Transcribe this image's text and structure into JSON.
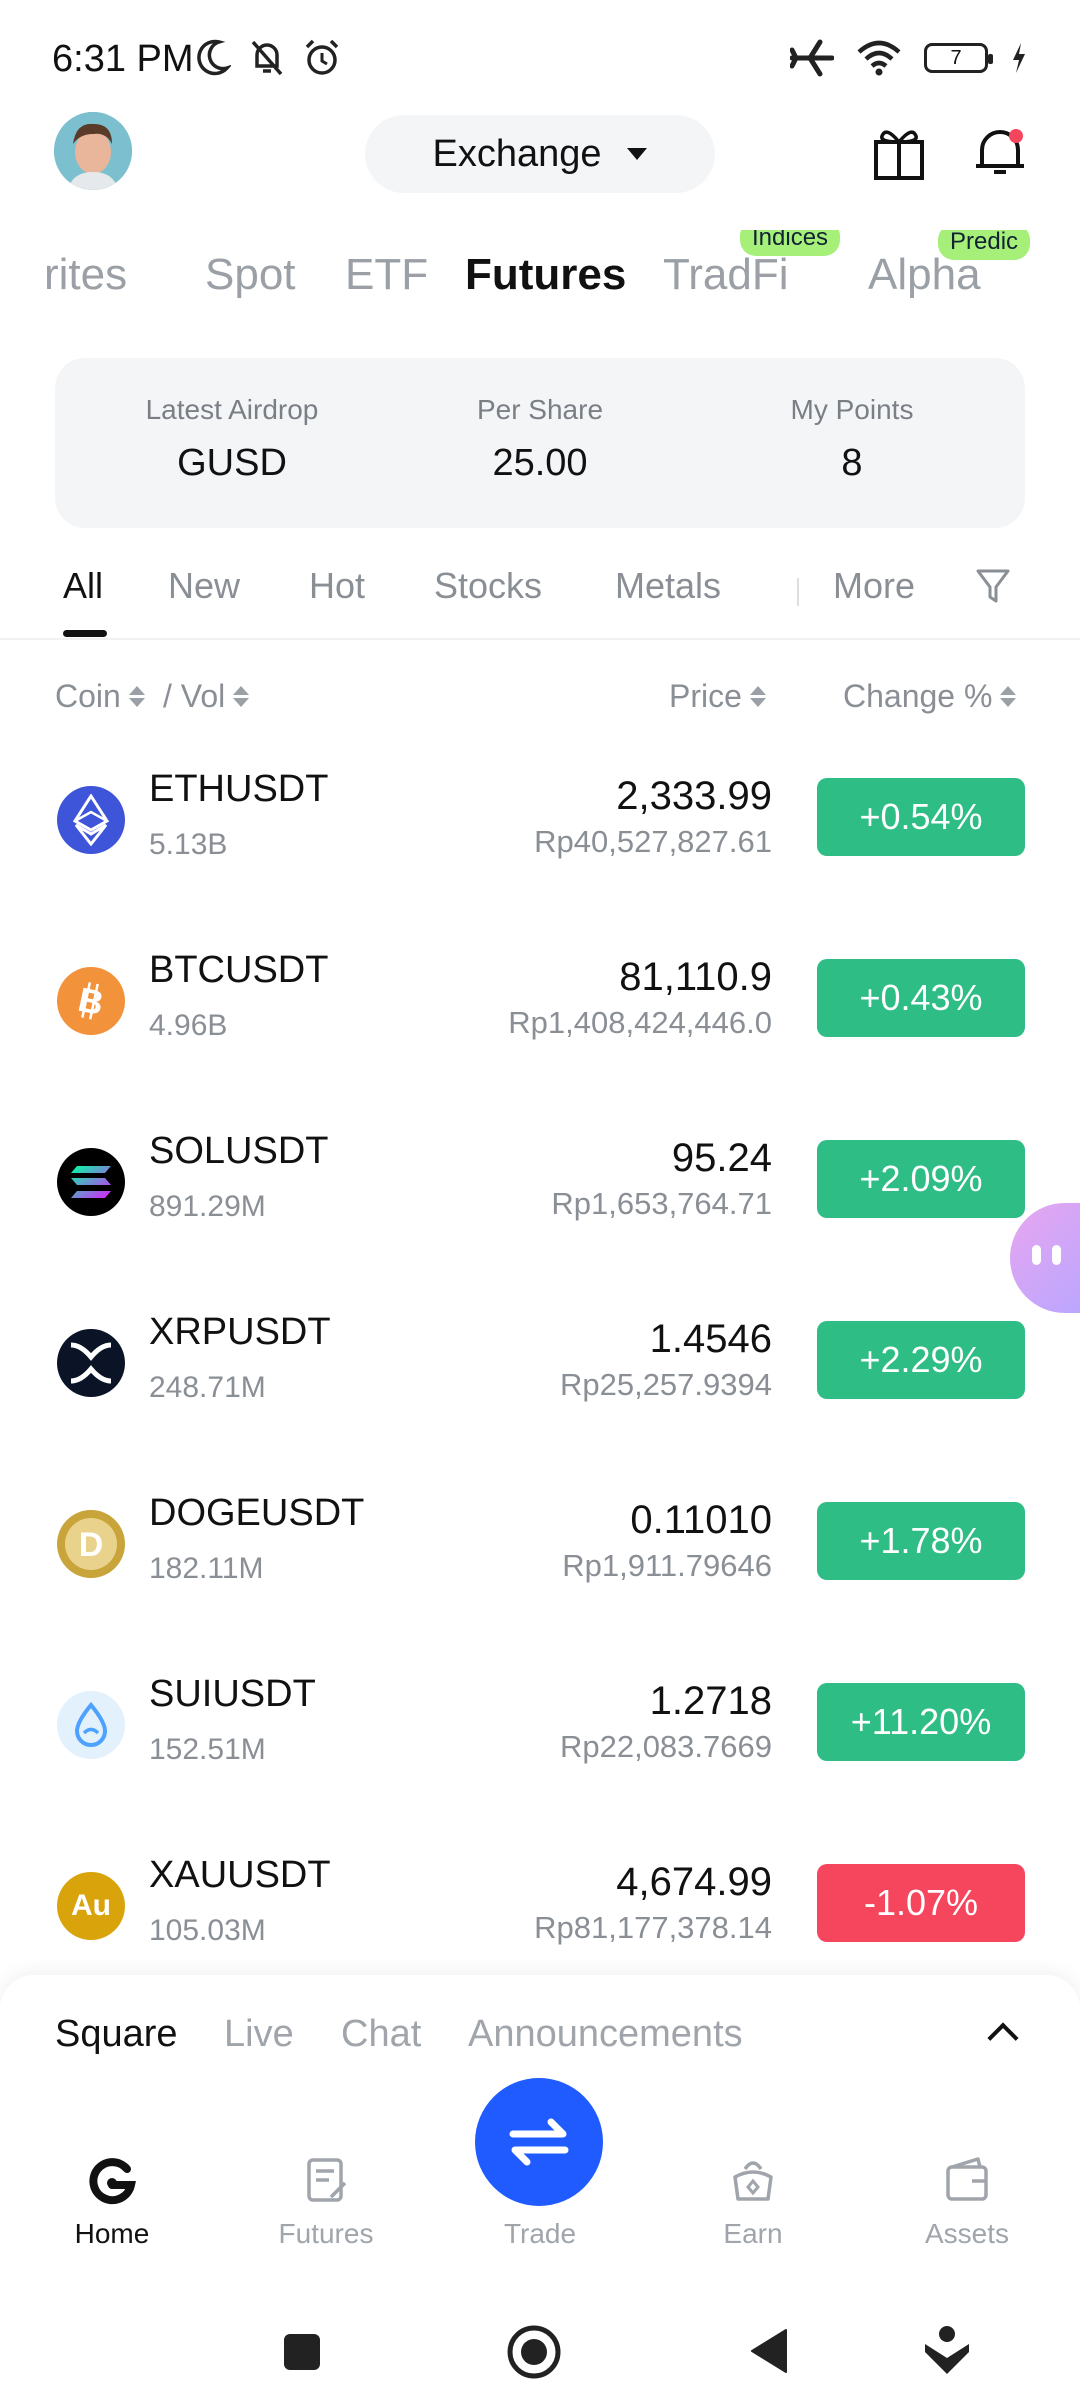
{
  "status": {
    "time": "6:31 PM",
    "battery": "7"
  },
  "header": {
    "exchange_label": "Exchange"
  },
  "top_tabs": [
    "rites",
    "Spot",
    "ETF",
    "Futures",
    "TradFi",
    "Alpha"
  ],
  "top_badges": {
    "tradfi": "Indices",
    "alpha": "Predic"
  },
  "airdrop": {
    "latest_label": "Latest Airdrop",
    "latest_value": "GUSD",
    "per_share_label": "Per Share",
    "per_share_value": "25.00",
    "points_label": "My Points",
    "points_value": "8"
  },
  "filters": [
    "All",
    "New",
    "Hot",
    "Stocks",
    "Metals",
    "More"
  ],
  "columns": {
    "coin": "Coin",
    "vol": "/ Vol",
    "price": "Price",
    "change": "Change %"
  },
  "rows": [
    {
      "symbol": "ETHUSDT",
      "vol": "5.13B",
      "price": "2,333.99",
      "fiat": "Rp40,527,827.61",
      "change": "+0.54%",
      "color": "#2ebd85"
    },
    {
      "symbol": "BTCUSDT",
      "vol": "4.96B",
      "price": "81,110.9",
      "fiat": "Rp1,408,424,446.0",
      "change": "+0.43%",
      "color": "#2ebd85"
    },
    {
      "symbol": "SOLUSDT",
      "vol": "891.29M",
      "price": "95.24",
      "fiat": "Rp1,653,764.71",
      "change": "+2.09%",
      "color": "#2ebd85"
    },
    {
      "symbol": "XRPUSDT",
      "vol": "248.71M",
      "price": "1.4546",
      "fiat": "Rp25,257.9394",
      "change": "+2.29%",
      "color": "#2ebd85"
    },
    {
      "symbol": "DOGEUSDT",
      "vol": "182.11M",
      "price": "0.11010",
      "fiat": "Rp1,911.79646",
      "change": "+1.78%",
      "color": "#2ebd85"
    },
    {
      "symbol": "SUIUSDT",
      "vol": "152.51M",
      "price": "1.2718",
      "fiat": "Rp22,083.7669",
      "change": "+11.20%",
      "color": "#2ebd85"
    },
    {
      "symbol": "XAUUSDT",
      "vol": "105.03M",
      "price": "4,674.99",
      "fiat": "Rp81,177,378.14",
      "change": "-1.07%",
      "color": "#f6465d"
    }
  ],
  "coin_icons": {
    "xau": "Au"
  },
  "feed_tabs": [
    "Square",
    "Live",
    "Chat",
    "Announcements"
  ],
  "nav": [
    "Home",
    "Futures",
    "Trade",
    "Earn",
    "Assets"
  ],
  "colors": {
    "up": "#2ebd85",
    "down": "#f6465d",
    "trade": "#1f5bff",
    "badge": "#a6f07a"
  }
}
